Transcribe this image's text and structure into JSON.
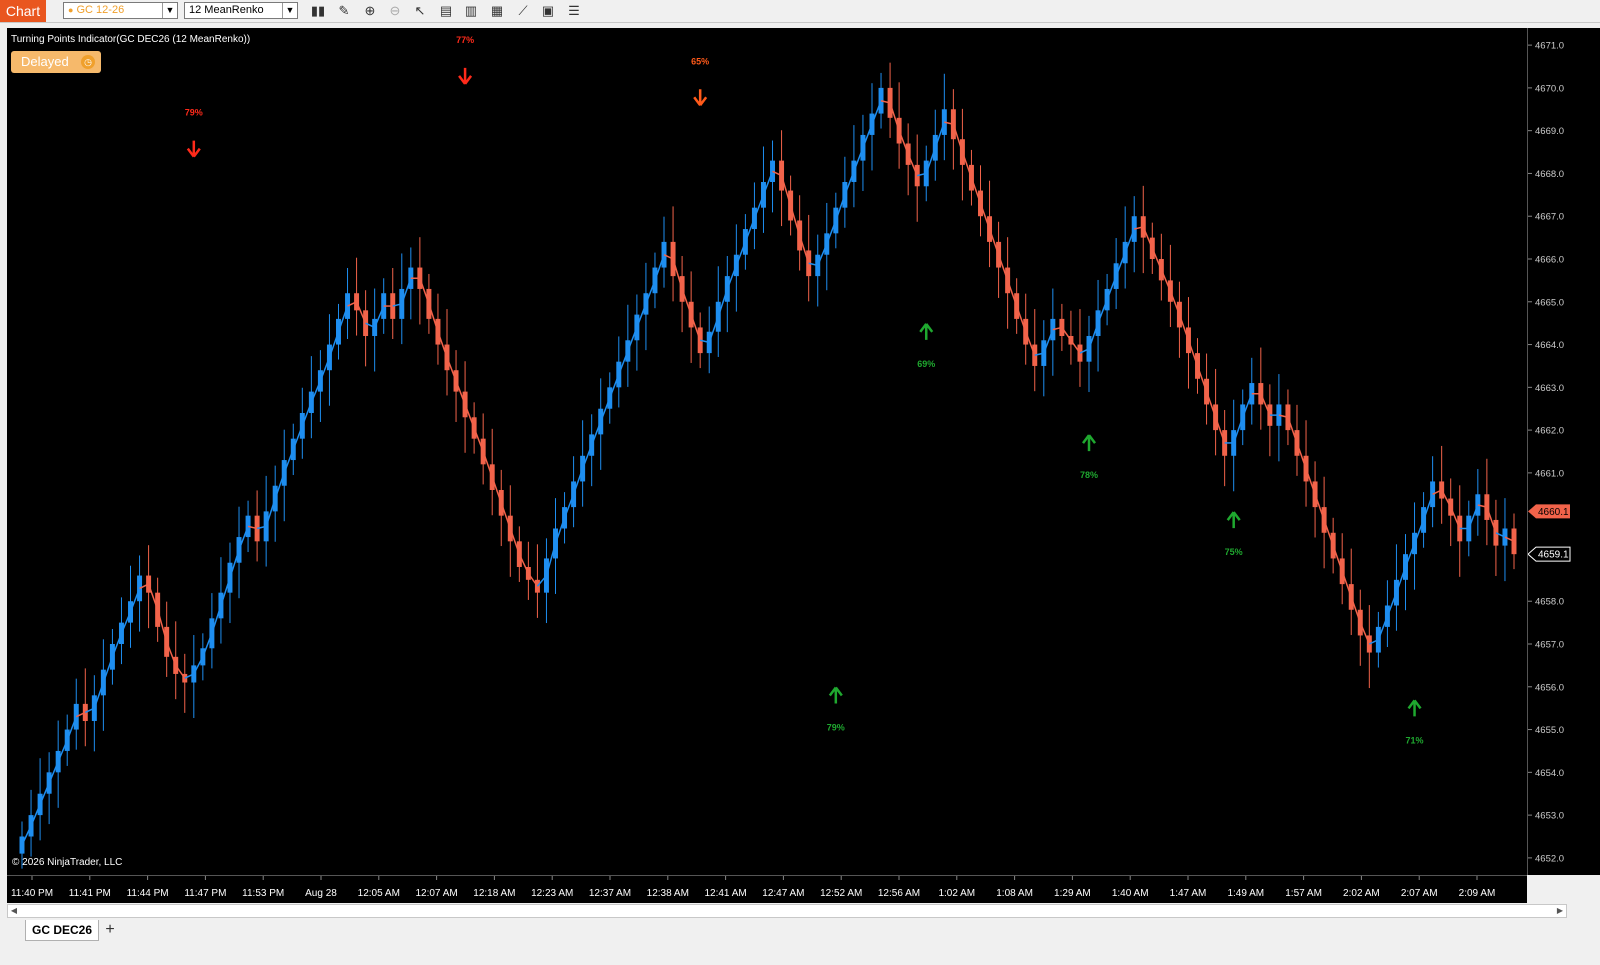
{
  "toolbar": {
    "chart_label": "Chart",
    "instrument": "GC 12-26",
    "bar_type": "12 MeanRenko",
    "icons": [
      "bars-icon",
      "pencil-icon",
      "zoom-in-icon",
      "zoom-out-icon",
      "pointer-icon",
      "data-box-icon",
      "bar-style-icon",
      "indicators-icon",
      "strategies-icon",
      "properties-icon",
      "list-icon"
    ]
  },
  "chart": {
    "indicator_label": "Turning Points Indicator(GC DEC26 (12 MeanRenko))",
    "delayed_label": "Delayed",
    "copyright": "© 2026 NinjaTrader, LLC",
    "current_price": "4660.1",
    "prev_price": "4659.1",
    "colors": {
      "up": "#1e8ef0",
      "down": "#f2634a",
      "signal_down": "#ff2a1a",
      "signal_down_alt": "#ff5a1a",
      "signal_up": "#1fa82f",
      "current_price_bg": "#f2634a",
      "background": "#000000"
    }
  },
  "price_axis": {
    "ticks": [
      "4671.0",
      "4670.0",
      "4669.0",
      "4668.0",
      "4667.0",
      "4666.0",
      "4665.0",
      "4664.0",
      "4663.0",
      "4662.0",
      "4661.0",
      "4660.1",
      "4659.1",
      "4658.0",
      "4657.0",
      "4656.0",
      "4655.0",
      "4654.0",
      "4653.0",
      "4652.0"
    ]
  },
  "time_axis": {
    "labels": [
      "11:40 PM",
      "11:41 PM",
      "11:44 PM",
      "11:47 PM",
      "11:53 PM",
      "Aug 28",
      "12:05 AM",
      "12:07 AM",
      "12:18 AM",
      "12:23 AM",
      "12:37 AM",
      "12:38 AM",
      "12:41 AM",
      "12:47 AM",
      "12:52 AM",
      "12:56 AM",
      "1:02 AM",
      "1:08 AM",
      "1:29 AM",
      "1:40 AM",
      "1:47 AM",
      "1:49 AM",
      "1:57 AM",
      "2:02 AM",
      "2:07 AM",
      "2:09 AM"
    ]
  },
  "chart_data": {
    "type": "candlestick",
    "instrument": "GC DEC26",
    "bar_type": "12 MeanRenko",
    "ylim": [
      4651.6,
      4671.4
    ],
    "closes": [
      4652.5,
      4653.0,
      4653.5,
      4654.0,
      4654.5,
      4655.0,
      4655.6,
      4655.2,
      4655.8,
      4656.4,
      4657.0,
      4657.5,
      4658.0,
      4658.6,
      4658.2,
      4657.4,
      4656.7,
      4656.3,
      4656.1,
      4656.5,
      4656.9,
      4657.6,
      4658.2,
      4658.9,
      4659.5,
      4660.0,
      4659.4,
      4660.1,
      4660.7,
      4661.3,
      4661.8,
      4662.4,
      4662.9,
      4663.4,
      4664.0,
      4664.6,
      4665.2,
      4664.8,
      4664.2,
      4664.6,
      4665.2,
      4664.6,
      4665.3,
      4665.8,
      4665.3,
      4664.6,
      4664.0,
      4663.4,
      4662.9,
      4662.3,
      4661.8,
      4661.2,
      4660.6,
      4660.0,
      4659.4,
      4658.8,
      4658.5,
      4658.2,
      4659.0,
      4659.7,
      4660.2,
      4660.8,
      4661.4,
      4661.9,
      4662.5,
      4663.0,
      4663.6,
      4664.1,
      4664.7,
      4665.2,
      4665.8,
      4666.4,
      4665.6,
      4665.0,
      4664.4,
      4663.8,
      4664.3,
      4665.0,
      4665.6,
      4666.1,
      4666.7,
      4667.2,
      4667.8,
      4668.3,
      4667.6,
      4666.9,
      4666.2,
      4665.6,
      4666.1,
      4666.6,
      4667.2,
      4667.8,
      4668.3,
      4668.9,
      4669.4,
      4670.0,
      4669.3,
      4668.7,
      4668.2,
      4667.7,
      4668.3,
      4668.9,
      4669.5,
      4668.8,
      4668.2,
      4667.6,
      4667.0,
      4666.4,
      4665.8,
      4665.2,
      4664.6,
      4664.0,
      4663.5,
      4664.1,
      4664.6,
      4664.2,
      4664.0,
      4663.6,
      4664.2,
      4664.8,
      4665.3,
      4665.9,
      4666.4,
      4667.0,
      4666.5,
      4666.0,
      4665.5,
      4665.0,
      4664.4,
      4663.8,
      4663.2,
      4662.6,
      4662.0,
      4661.4,
      4662.0,
      4662.6,
      4663.1,
      4662.6,
      4662.1,
      4662.6,
      4662.0,
      4661.4,
      4660.8,
      4660.2,
      4659.6,
      4659.0,
      4658.4,
      4657.8,
      4657.2,
      4656.8,
      4657.4,
      4657.9,
      4658.5,
      4659.1,
      4659.6,
      4660.2,
      4660.8,
      4660.4,
      4660.0,
      4659.4,
      4660.0,
      4660.5,
      4659.9,
      4659.3,
      4659.7,
      4659.1
    ]
  },
  "signals": [
    {
      "type": "sell",
      "label": "79%",
      "price": 4668.3
    },
    {
      "type": "sell",
      "label": "77%",
      "price": 4670.0
    },
    {
      "type": "sell",
      "label": "65%",
      "price": 4669.5
    },
    {
      "type": "buy",
      "label": "79%",
      "price": 4656.1
    },
    {
      "type": "buy",
      "label": "69%",
      "price": 4664.6
    },
    {
      "type": "buy",
      "label": "78%",
      "price": 4662.0
    },
    {
      "type": "buy",
      "label": "75%",
      "price": 4660.2
    },
    {
      "type": "buy",
      "label": "71%",
      "price": 4655.8
    }
  ]
}
